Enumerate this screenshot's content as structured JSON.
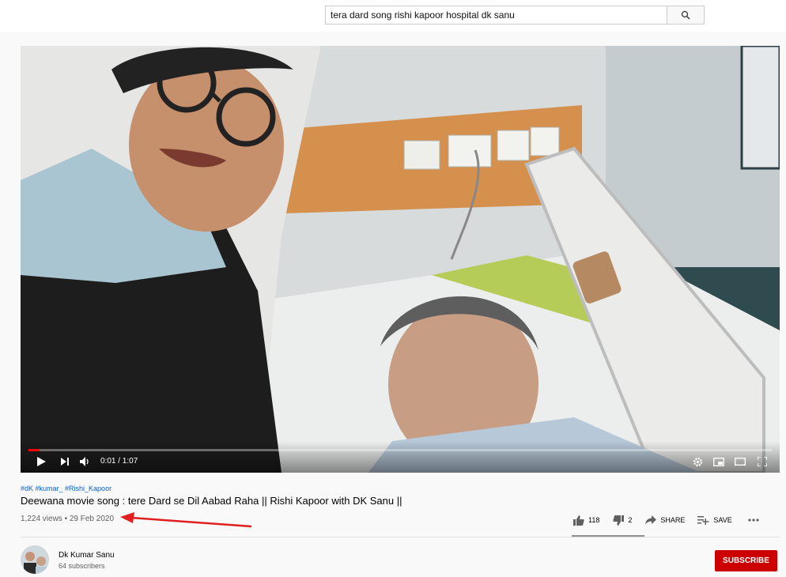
{
  "search": {
    "query": "tera dard song rishi kapoor hospital dk sanu"
  },
  "player": {
    "current_time": "0:01",
    "duration": "1:07",
    "time_display": "0:01 / 1:07",
    "progress": 0.015
  },
  "video": {
    "hashtags": "#dK #kumar_ #Rishi_Kapoor",
    "title": "Deewana movie song : tere Dard se Dil Aabad Raha || Rishi Kapoor with DK Sanu ||",
    "views_date": "1,224 views • 29 Feb 2020"
  },
  "actions": {
    "likes": "118",
    "dislikes": "2",
    "share": "SHARE",
    "save": "SAVE"
  },
  "channel": {
    "name": "Dk Kumar Sanu",
    "subscribers": "64 subscribers",
    "subscribe": "SUBSCRIBE"
  },
  "colors": {
    "subscribe_bg": "#cc0000",
    "progress": "#ff0000",
    "hashtag": "#065fd4",
    "annotation_arrow": "#e02020"
  }
}
